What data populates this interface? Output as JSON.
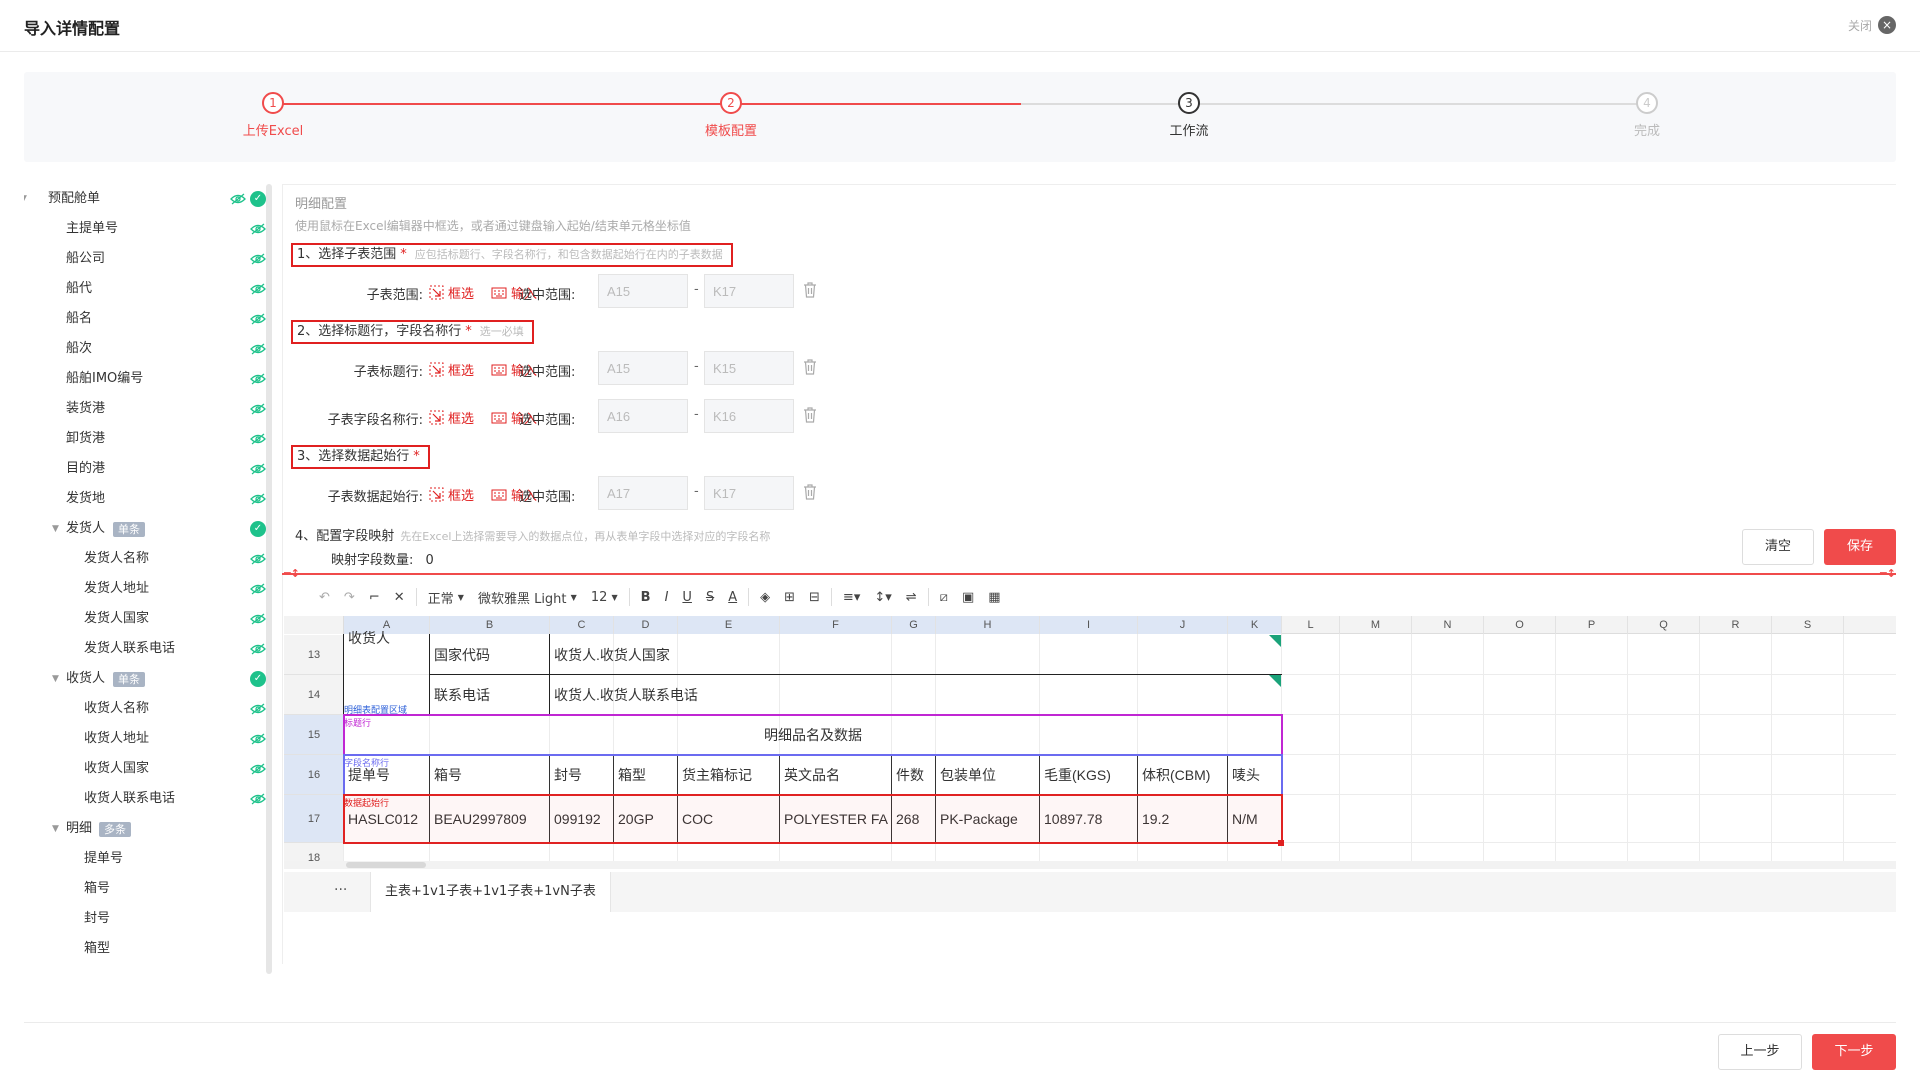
{
  "header": {
    "title": "导入详情配置",
    "close_label": "关闭",
    "close_icon": "×"
  },
  "stepper": {
    "steps": [
      {
        "num": "1",
        "label": "上传Excel",
        "state": "done"
      },
      {
        "num": "2",
        "label": "模板配置",
        "state": "active"
      },
      {
        "num": "3",
        "label": "工作流",
        "state": "next"
      },
      {
        "num": "4",
        "label": "完成",
        "state": "pending"
      }
    ],
    "colors": {
      "done": "#f04b4b",
      "next": "#333333",
      "pending": "#cccccc"
    }
  },
  "tree": {
    "items": [
      {
        "label": "预配舱单",
        "level": 0,
        "expand": true,
        "check": true
      },
      {
        "label": "主提单号",
        "level": 1
      },
      {
        "label": "船公司",
        "level": 1
      },
      {
        "label": "船代",
        "level": 1
      },
      {
        "label": "船名",
        "level": 1
      },
      {
        "label": "船次",
        "level": 1
      },
      {
        "label": "船舶IMO编号",
        "level": 1
      },
      {
        "label": "装货港",
        "level": 1
      },
      {
        "label": "卸货港",
        "level": 1
      },
      {
        "label": "目的港",
        "level": 1
      },
      {
        "label": "发货地",
        "level": 1
      },
      {
        "label": "发货人",
        "level": 1,
        "expand": true,
        "badge": "单条",
        "check": true,
        "noeye": true
      },
      {
        "label": "发货人名称",
        "level": 2
      },
      {
        "label": "发货人地址",
        "level": 2
      },
      {
        "label": "发货人国家",
        "level": 2
      },
      {
        "label": "发货人联系电话",
        "level": 2
      },
      {
        "label": "收货人",
        "level": 1,
        "expand": true,
        "badge": "单条",
        "check": true,
        "noeye": true
      },
      {
        "label": "收货人名称",
        "level": 2
      },
      {
        "label": "收货人地址",
        "level": 2
      },
      {
        "label": "收货人国家",
        "level": 2
      },
      {
        "label": "收货人联系电话",
        "level": 2
      },
      {
        "label": "明细",
        "level": 1,
        "expand": true,
        "badge": "多条",
        "noeye": true
      },
      {
        "label": "提单号",
        "level": 2,
        "noeye": true
      },
      {
        "label": "箱号",
        "level": 2,
        "noeye": true
      },
      {
        "label": "封号",
        "level": 2,
        "noeye": true
      },
      {
        "label": "箱型",
        "level": 2,
        "noeye": true
      }
    ]
  },
  "config": {
    "title": "明细配置",
    "hint": "使用鼠标在Excel编辑器中框选，或者通过键盘输入起始/结束单元格坐标值",
    "sec1": {
      "label": "1、选择子表范围",
      "star": "*",
      "tip": "应包括标题行、字段名称行，和包含数据起始行在内的子表数据"
    },
    "sec2": {
      "label": "2、选择标题行，字段名称行",
      "star": "*",
      "tip": "选一必填"
    },
    "sec3": {
      "label": "3、选择数据起始行",
      "star": "*"
    },
    "frame_label": "框选",
    "input_label": "输入",
    "select_range_label": "选中范围:",
    "rows": [
      {
        "label": "子表范围:",
        "from": "A15",
        "to": "K17"
      },
      {
        "label": "子表标题行:",
        "from": "A15",
        "to": "K15"
      },
      {
        "label": "子表字段名称行:",
        "from": "A16",
        "to": "K16"
      },
      {
        "label": "子表数据起始行:",
        "from": "A17",
        "to": "K17"
      }
    ],
    "mapping": {
      "label": "4、配置字段映射",
      "tip": "先在Excel上选择需要导入的数据点位，再从表单字段中选择对应的字段名称",
      "count_label": "映射字段数量:",
      "count": "0"
    },
    "clear_label": "清空",
    "save_label": "保存"
  },
  "toolbar": {
    "style": "正常",
    "font": "微软雅黑 Light",
    "size": "12",
    "bold": "B",
    "italic": "I",
    "underline": "U",
    "strike": "S",
    "fontcolor": "A"
  },
  "sheet": {
    "columns": [
      "A",
      "B",
      "C",
      "D",
      "E",
      "F",
      "G",
      "H",
      "I",
      "J",
      "K",
      "L",
      "M",
      "N",
      "O",
      "P",
      "Q",
      "R",
      "S"
    ],
    "rows": [
      "13",
      "14",
      "15",
      "16",
      "17",
      "18"
    ],
    "cut_text": "收货人",
    "row13": {
      "label": "国家代码",
      "value": "收货人.收货人国家"
    },
    "row14": {
      "label": "联系电话",
      "value": "收货人.收货人联系电话"
    },
    "row15_title": "明细品名及数据",
    "headers": [
      "提单号",
      "箱号",
      "封号",
      "箱型",
      "货主箱标记",
      "英文品名",
      "件数",
      "包装单位",
      "毛重(KGS)",
      "体积(CBM)",
      "唛头"
    ],
    "data": [
      "HASLC012",
      "BEAU2997809",
      "099192",
      "20GP",
      "COC",
      "POLYESTER FA",
      "268",
      "PK-Package",
      "10897.78",
      "19.2",
      "N/M"
    ],
    "tags": {
      "region": "明细表配置区域",
      "title": "标题行",
      "field": "字段名称行",
      "data": "数据起始行"
    },
    "tab_more": "···",
    "tab": "主表+1v1子表+1v1子表+1vN子表"
  },
  "footer": {
    "prev_label": "上一步",
    "next_label": "下一步"
  }
}
